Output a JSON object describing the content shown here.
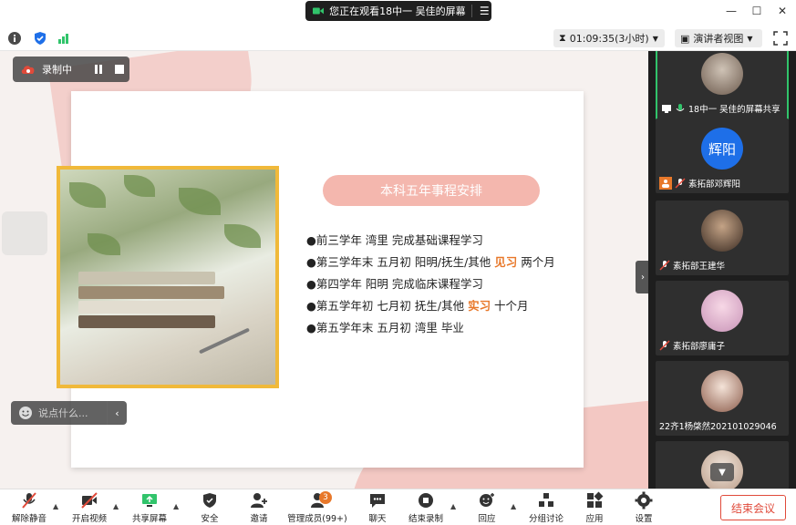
{
  "title_bar": {
    "share_banner_text": "您正在观看18中一 吴佳的屏幕",
    "menu_icon": "menu-icon",
    "window_controls": [
      "minimize",
      "maximize",
      "close"
    ]
  },
  "info_bar": {
    "timer": "01:09:35(3小时)",
    "view_mode": "演讲者视图",
    "icons": [
      "info-icon",
      "shield-icon",
      "signal-icon",
      "fullscreen-icon"
    ]
  },
  "recording": {
    "label": "录制中"
  },
  "chat": {
    "placeholder": "说点什么..."
  },
  "slide": {
    "heading": "本科五年事程安排",
    "items": [
      {
        "bullet": "●",
        "text": "前三学年 湾里 完成基础课程学习",
        "highlight": "",
        "tail": ""
      },
      {
        "bullet": "●",
        "text": "第三学年末 五月初 阳明/抚生/其他 ",
        "highlight": "见习",
        "tail": " 两个月"
      },
      {
        "bullet": "●",
        "text": "第四学年 阳明 完成临床课程学习",
        "highlight": "",
        "tail": ""
      },
      {
        "bullet": "●",
        "text": "第五学年初 七月初 抚生/其他 ",
        "highlight": "实习",
        "tail": " 十个月"
      },
      {
        "bullet": "●",
        "text": "第五学年末 五月初 湾里 毕业",
        "highlight": "",
        "tail": ""
      }
    ],
    "highlight_color": "#e8782a",
    "pill_color": "#f4b7ae"
  },
  "participants": [
    {
      "name": "18中一 吴佳的屏幕共享",
      "avatar": "photo",
      "active": true
    },
    {
      "name": "素拓部邓辉阳",
      "avatar_text": "辉阳",
      "host": true
    },
    {
      "name": "素拓部王建华",
      "avatar": "photo"
    },
    {
      "name": "素拓部廖庸子",
      "avatar": "photo"
    },
    {
      "name": "22齐1杨棨然202101029046",
      "avatar": "photo"
    },
    {
      "name": "",
      "avatar": "photo"
    }
  ],
  "toolbar": {
    "unmute": "解除静音",
    "video": "开启视频",
    "share": "共享屏幕",
    "security": "安全",
    "invite": "邀请",
    "members": "管理成员(99+)",
    "members_badge": "3",
    "chat": "聊天",
    "record": "结束录制",
    "reactions": "回应",
    "breakout": "分组讨论",
    "apps": "应用",
    "settings": "设置",
    "end_meeting": "结束会议"
  },
  "accent_colors": {
    "green": "#31c46b",
    "orange": "#e8782a",
    "red": "#e04a3a",
    "blue": "#1e6fe8"
  }
}
